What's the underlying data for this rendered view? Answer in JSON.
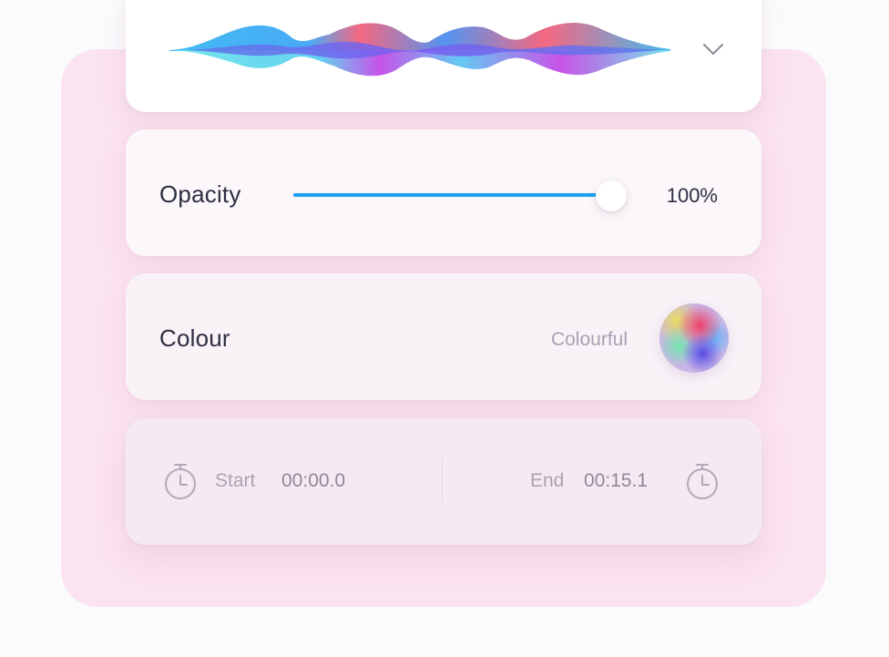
{
  "waveform": {
    "icon": "waveform-graphic",
    "colors": [
      "#38b6f2",
      "#7a5cf0",
      "#c54ae6",
      "#f4607a",
      "#6fe3e9"
    ]
  },
  "dropdown": {
    "icon": "chevron-down-icon"
  },
  "opacity": {
    "label": "Opacity",
    "value_text": "100%",
    "level": 1.0,
    "track_color": "#1aa0ee"
  },
  "colour": {
    "label": "Colour",
    "value": "Colourful",
    "swatch_icon": "color-wheel-swatch"
  },
  "timing": {
    "start": {
      "icon": "stopwatch-icon",
      "label": "Start",
      "value": "00:00.0"
    },
    "end": {
      "icon": "stopwatch-icon",
      "label": "End",
      "value": "00:15.1"
    }
  },
  "theme": {
    "backdrop": "#fbe3ef",
    "text_primary": "#2d2f42",
    "text_muted": "#a7a2b3",
    "accent": "#1aa0ee"
  }
}
